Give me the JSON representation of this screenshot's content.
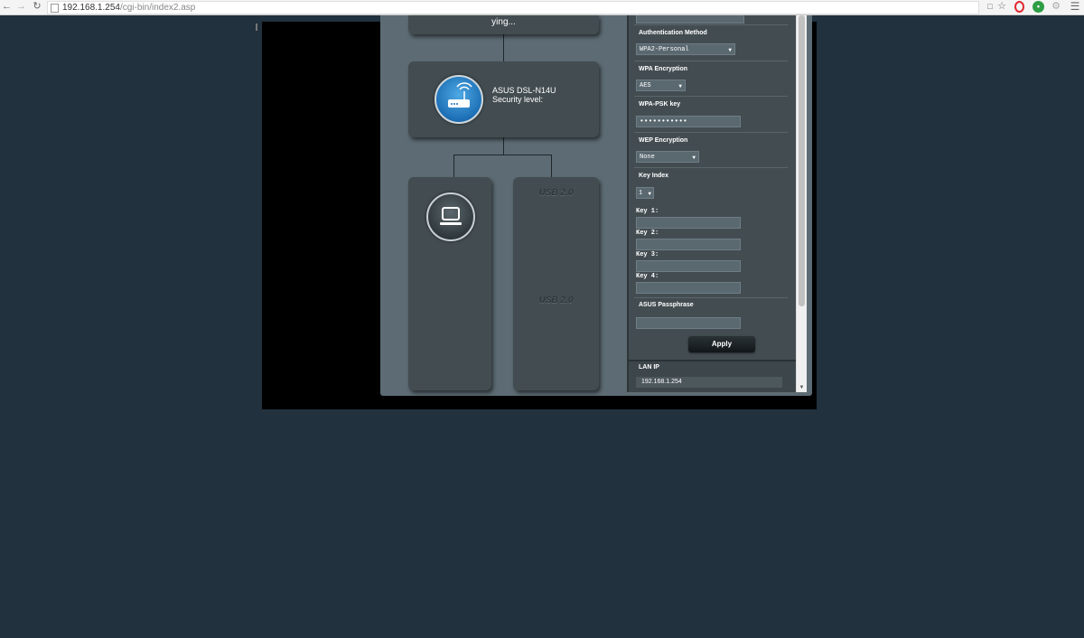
{
  "browser": {
    "url_host": "192.168.1.254",
    "url_path": "/cgi-bin/index2.asp",
    "nav_icons": [
      "back-arrow-icon",
      "forward-arrow-icon",
      "reload-icon"
    ],
    "extension_icons": [
      "translate-icon",
      "bookmark-star-icon",
      "opera-icon",
      "green-circle-extension-icon",
      "settings-wrench-icon",
      "menu-icon"
    ]
  },
  "network_map": {
    "top_node_text": "ying...",
    "router": {
      "name": "ASUS DSL-N14U",
      "security_label": "Security level:"
    },
    "usb_ports": [
      "USB 2.0",
      "USB 2.0"
    ]
  },
  "wireless_settings": {
    "ssid_value": "",
    "authentication_method": {
      "label": "Authentication Method",
      "value": "WPA2-Personal"
    },
    "wpa_encryption": {
      "label": "WPA Encryption",
      "value": "AES"
    },
    "wpa_psk_key": {
      "label": "WPA-PSK key",
      "value": "•••••••••••"
    },
    "wep_encryption": {
      "label": "WEP Encryption",
      "value": "None"
    },
    "key_index": {
      "label": "Key Index",
      "value": "1"
    },
    "keys": [
      {
        "label": "Key 1:",
        "value": ""
      },
      {
        "label": "Key 2:",
        "value": ""
      },
      {
        "label": "Key 3:",
        "value": ""
      },
      {
        "label": "Key 4:",
        "value": ""
      }
    ],
    "asus_passphrase": {
      "label": "ASUS Passphrase",
      "value": ""
    },
    "apply_label": "Apply"
  },
  "lan": {
    "label": "LAN IP",
    "ip": "192.168.1.254"
  },
  "colors": {
    "page_background": "#21313d",
    "panel": "#5d6c74",
    "node": "#434d51",
    "router_blue": "#1d6fb5"
  }
}
